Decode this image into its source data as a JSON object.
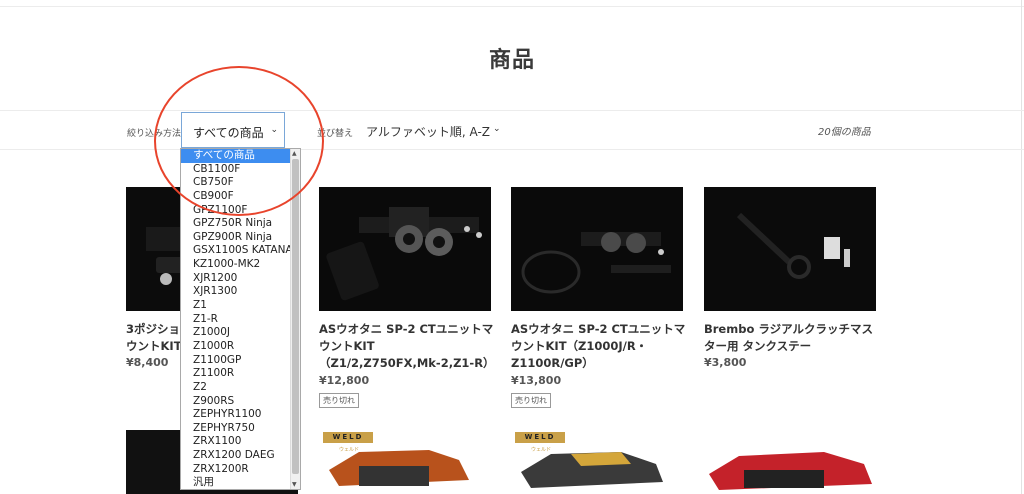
{
  "page": {
    "title": "商品"
  },
  "filter": {
    "label": "絞り込み方法",
    "selected": "すべての商品",
    "options": [
      "すべての商品",
      "CB1100F",
      "CB750F",
      "CB900F",
      "GPZ1100F",
      "GPZ750R Ninja",
      "GPZ900R Ninja",
      "GSX1100S KATANA",
      "KZ1000-MK2",
      "XJR1200",
      "XJR1300",
      "Z1",
      "Z1-R",
      "Z1000J",
      "Z1000R",
      "Z1100GP",
      "Z1100R",
      "Z2",
      "Z900RS",
      "ZEPHYR1100",
      "ZEPHYR750",
      "ZRX1100",
      "ZRX1200 DAEG",
      "ZRX1200R",
      "汎用"
    ]
  },
  "sort": {
    "label": "並び替え",
    "value": "アルファベット順, A-Z"
  },
  "count": "20個の商品",
  "products": [
    {
      "title": "3ポジショ\nウントKIT",
      "price": "¥8,400",
      "soldout": ""
    },
    {
      "title": "ASウオタニ SP-2 CTユニットマウントKIT（Z1/2,Z750FX,Mk-2,Z1-R）",
      "price": "¥12,800",
      "soldout": "売り切れ"
    },
    {
      "title": "ASウオタニ SP-2 CTユニットマウントKIT（Z1000J/R・Z1100R/GP）",
      "price": "¥13,800",
      "soldout": "売り切れ"
    },
    {
      "title": "Brembo ラジアルクラッチマスター用 タンクステー",
      "price": "¥3,800",
      "soldout": ""
    }
  ],
  "weld": {
    "logo": "WELD",
    "sub": "ウェルド"
  },
  "colors": {
    "accent": "#3d8df0",
    "annotation": "#e8442c"
  },
  "icons": {
    "select_arrow": "chevron-down-icon",
    "scroll_up": "triangle-up-icon",
    "scroll_down": "triangle-down-icon"
  }
}
